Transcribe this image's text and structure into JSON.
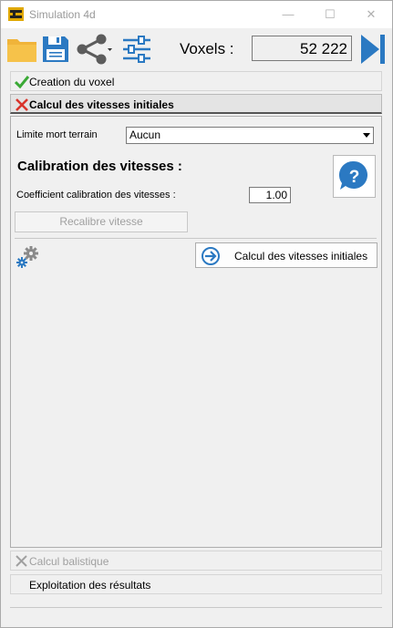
{
  "window": {
    "title": "Simulation 4d",
    "minimize": "—",
    "maximize": "☐",
    "close": "✕"
  },
  "toolbar": {
    "icons": [
      "folder-icon",
      "save-icon",
      "share-icon",
      "settings-sliders-icon",
      "play-next-icon"
    ],
    "voxels_label": "Voxels :",
    "voxels_value": "52 222"
  },
  "steps": {
    "creation": "Creation du voxel",
    "calcul_vitesses": "Calcul des vitesses initiales",
    "calcul_balistique": "Calcul balistique",
    "exploitation": "Exploitation des résultats"
  },
  "panel": {
    "limite_label": "Limite mort terrain",
    "limite_value": "Aucun",
    "calibration_title": "Calibration des vitesses :",
    "coef_label": "Coefficient calibration des vitesses :",
    "coef_value": "1.00",
    "recalibre_button": "Recalibre vitesse",
    "calc_button": "Calcul des vitesses initiales"
  },
  "colors": {
    "accent_blue": "#2b79c2",
    "folder_yellow": "#f6c24a",
    "check_green": "#3aa935",
    "cross_red": "#d9342b"
  }
}
